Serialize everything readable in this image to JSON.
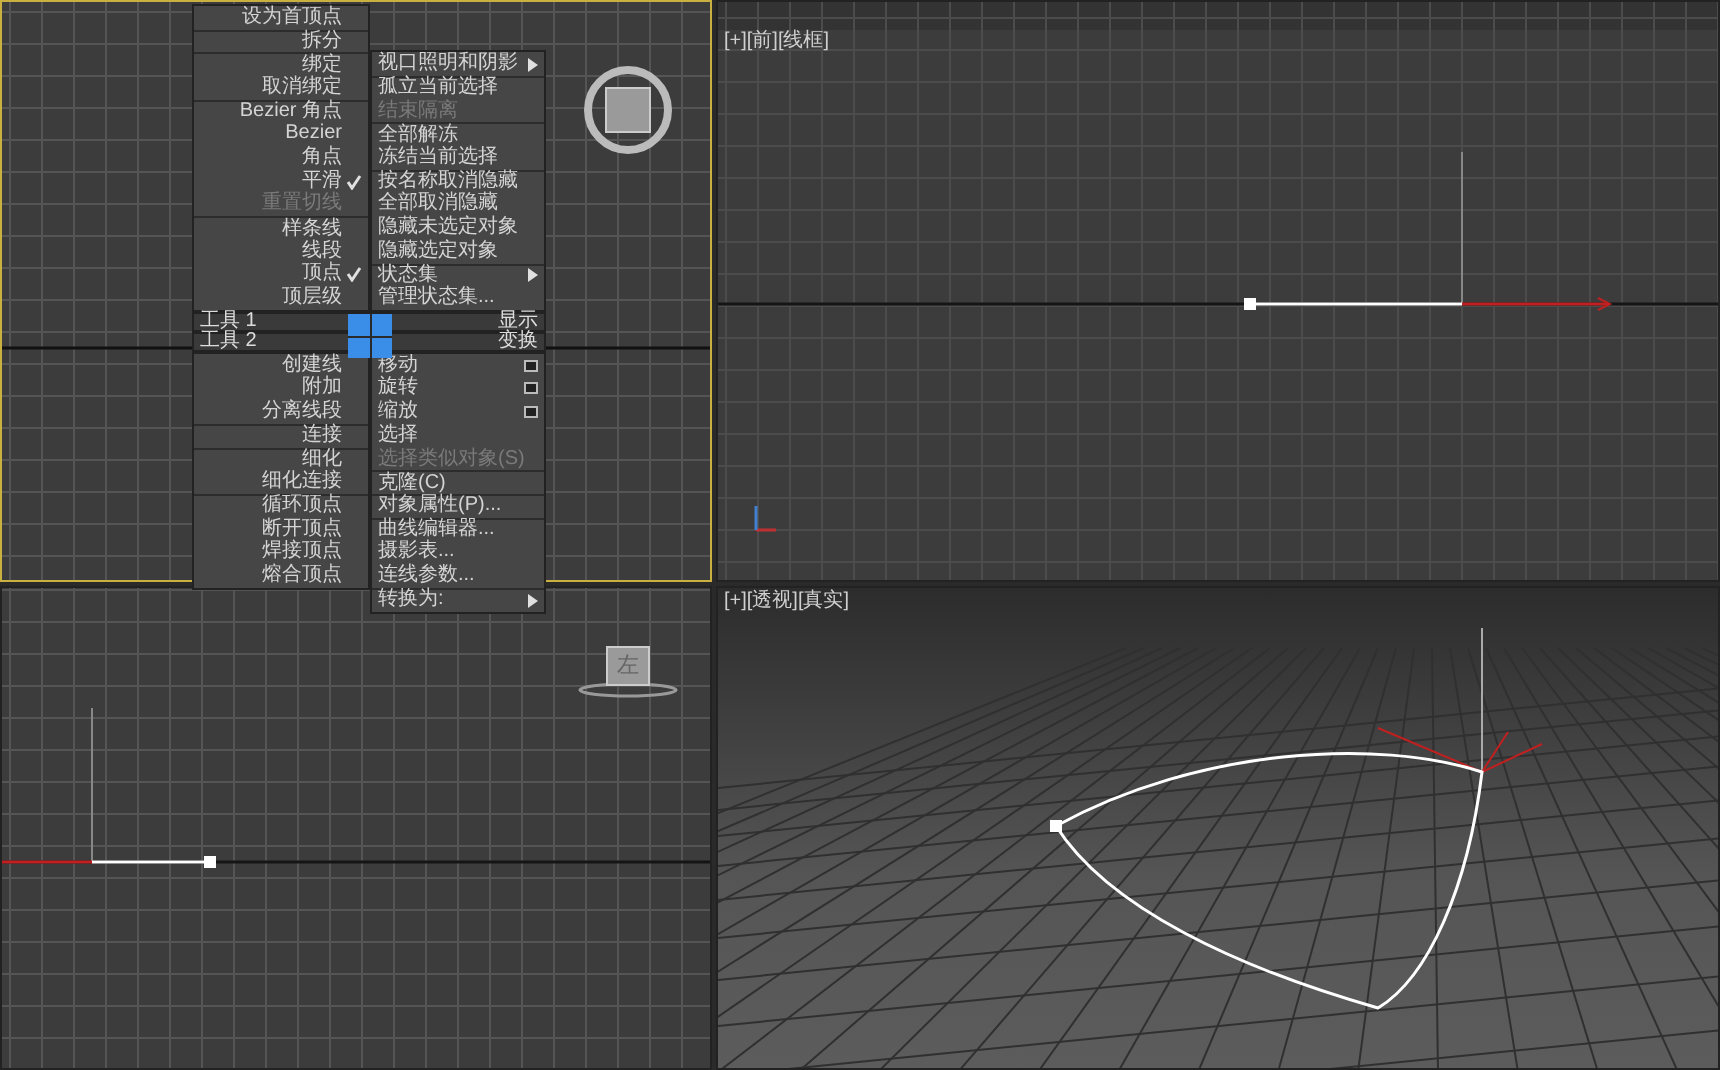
{
  "viewports": [
    {
      "kind": "top",
      "active": true
    },
    {
      "kind": "front",
      "active": false,
      "label": "[+][前][线框]"
    },
    {
      "kind": "left",
      "active": false,
      "viewcube_label": "左"
    },
    {
      "kind": "perspective",
      "active": false,
      "label": "[+][透视][真实]"
    }
  ],
  "quad_menu": {
    "top_left": [
      {
        "label": "设为首顶点",
        "checked": false,
        "disabled": false,
        "divider_above": false
      },
      {
        "label": "拆分",
        "checked": false,
        "disabled": false,
        "divider_above": true
      },
      {
        "label": "绑定",
        "checked": false,
        "disabled": false,
        "divider_above": true
      },
      {
        "label": "取消绑定",
        "checked": false,
        "disabled": false,
        "divider_above": false
      },
      {
        "label": "Bezier 角点",
        "checked": false,
        "disabled": false,
        "divider_above": true
      },
      {
        "label": "Bezier",
        "checked": false,
        "disabled": false,
        "divider_above": false
      },
      {
        "label": "角点",
        "checked": false,
        "disabled": false,
        "divider_above": false
      },
      {
        "label": "平滑",
        "checked": true,
        "disabled": false,
        "divider_above": false
      },
      {
        "label": "重置切线",
        "checked": false,
        "disabled": true,
        "divider_above": false
      },
      {
        "label": "样条线",
        "checked": false,
        "disabled": false,
        "divider_above": true
      },
      {
        "label": "线段",
        "checked": false,
        "disabled": false,
        "divider_above": false
      },
      {
        "label": "顶点",
        "checked": true,
        "disabled": false,
        "divider_above": false
      },
      {
        "label": "顶层级",
        "checked": false,
        "disabled": false,
        "divider_above": false
      }
    ],
    "top_right": [
      {
        "label": "视口照明和阴影",
        "submenu": true,
        "disabled": false,
        "divider_above": false
      },
      {
        "label": "孤立当前选择",
        "submenu": false,
        "disabled": false,
        "divider_above": true
      },
      {
        "label": "结束隔离",
        "submenu": false,
        "disabled": true,
        "divider_above": false
      },
      {
        "label": "全部解冻",
        "submenu": false,
        "disabled": false,
        "divider_above": true
      },
      {
        "label": "冻结当前选择",
        "submenu": false,
        "disabled": false,
        "divider_above": false
      },
      {
        "label": "按名称取消隐藏",
        "submenu": false,
        "disabled": false,
        "divider_above": true
      },
      {
        "label": "全部取消隐藏",
        "submenu": false,
        "disabled": false,
        "divider_above": false
      },
      {
        "label": "隐藏未选定对象",
        "submenu": false,
        "disabled": false,
        "divider_above": false
      },
      {
        "label": "隐藏选定对象",
        "submenu": false,
        "disabled": false,
        "divider_above": false
      },
      {
        "label": "状态集",
        "submenu": true,
        "disabled": false,
        "divider_above": true
      },
      {
        "label": "管理状态集...",
        "submenu": false,
        "disabled": false,
        "divider_above": false
      }
    ],
    "quadrant_titles": [
      {
        "left": "工具 1",
        "right": "显示"
      },
      {
        "left": "工具 2",
        "right": "变换"
      }
    ],
    "bottom_left": [
      {
        "label": "创建线",
        "disabled": false,
        "divider_above": false
      },
      {
        "label": "附加",
        "disabled": false,
        "divider_above": false
      },
      {
        "label": "分离线段",
        "disabled": false,
        "divider_above": false
      },
      {
        "label": "连接",
        "disabled": false,
        "divider_above": true
      },
      {
        "label": "细化",
        "disabled": false,
        "divider_above": true
      },
      {
        "label": "细化连接",
        "disabled": false,
        "divider_above": false
      },
      {
        "label": "循环顶点",
        "disabled": false,
        "divider_above": true
      },
      {
        "label": "断开顶点",
        "disabled": false,
        "divider_above": false
      },
      {
        "label": "焊接顶点",
        "disabled": false,
        "divider_above": false
      },
      {
        "label": "熔合顶点",
        "disabled": false,
        "divider_above": false
      }
    ],
    "bottom_right": [
      {
        "label": "移动",
        "options_box": true,
        "submenu": false,
        "disabled": false,
        "divider_above": false
      },
      {
        "label": "旋转",
        "options_box": true,
        "submenu": false,
        "disabled": false,
        "divider_above": false
      },
      {
        "label": "缩放",
        "options_box": true,
        "submenu": false,
        "disabled": false,
        "divider_above": false
      },
      {
        "label": "选择",
        "options_box": false,
        "submenu": false,
        "disabled": false,
        "divider_above": false
      },
      {
        "label": "选择类似对象(S)",
        "options_box": false,
        "submenu": false,
        "disabled": true,
        "divider_above": false
      },
      {
        "label": "克隆(C)",
        "options_box": false,
        "submenu": false,
        "disabled": false,
        "divider_above": true
      },
      {
        "label": "对象属性(P)...",
        "options_box": false,
        "submenu": false,
        "disabled": false,
        "divider_above": true
      },
      {
        "label": "曲线编辑器...",
        "options_box": false,
        "submenu": false,
        "disabled": false,
        "divider_above": true
      },
      {
        "label": "摄影表...",
        "options_box": false,
        "submenu": false,
        "disabled": false,
        "divider_above": false
      },
      {
        "label": "连线参数...",
        "options_box": false,
        "submenu": false,
        "disabled": false,
        "divider_above": false
      },
      {
        "label": "转换为:",
        "options_box": false,
        "submenu": true,
        "disabled": false,
        "divider_above": true
      }
    ]
  }
}
